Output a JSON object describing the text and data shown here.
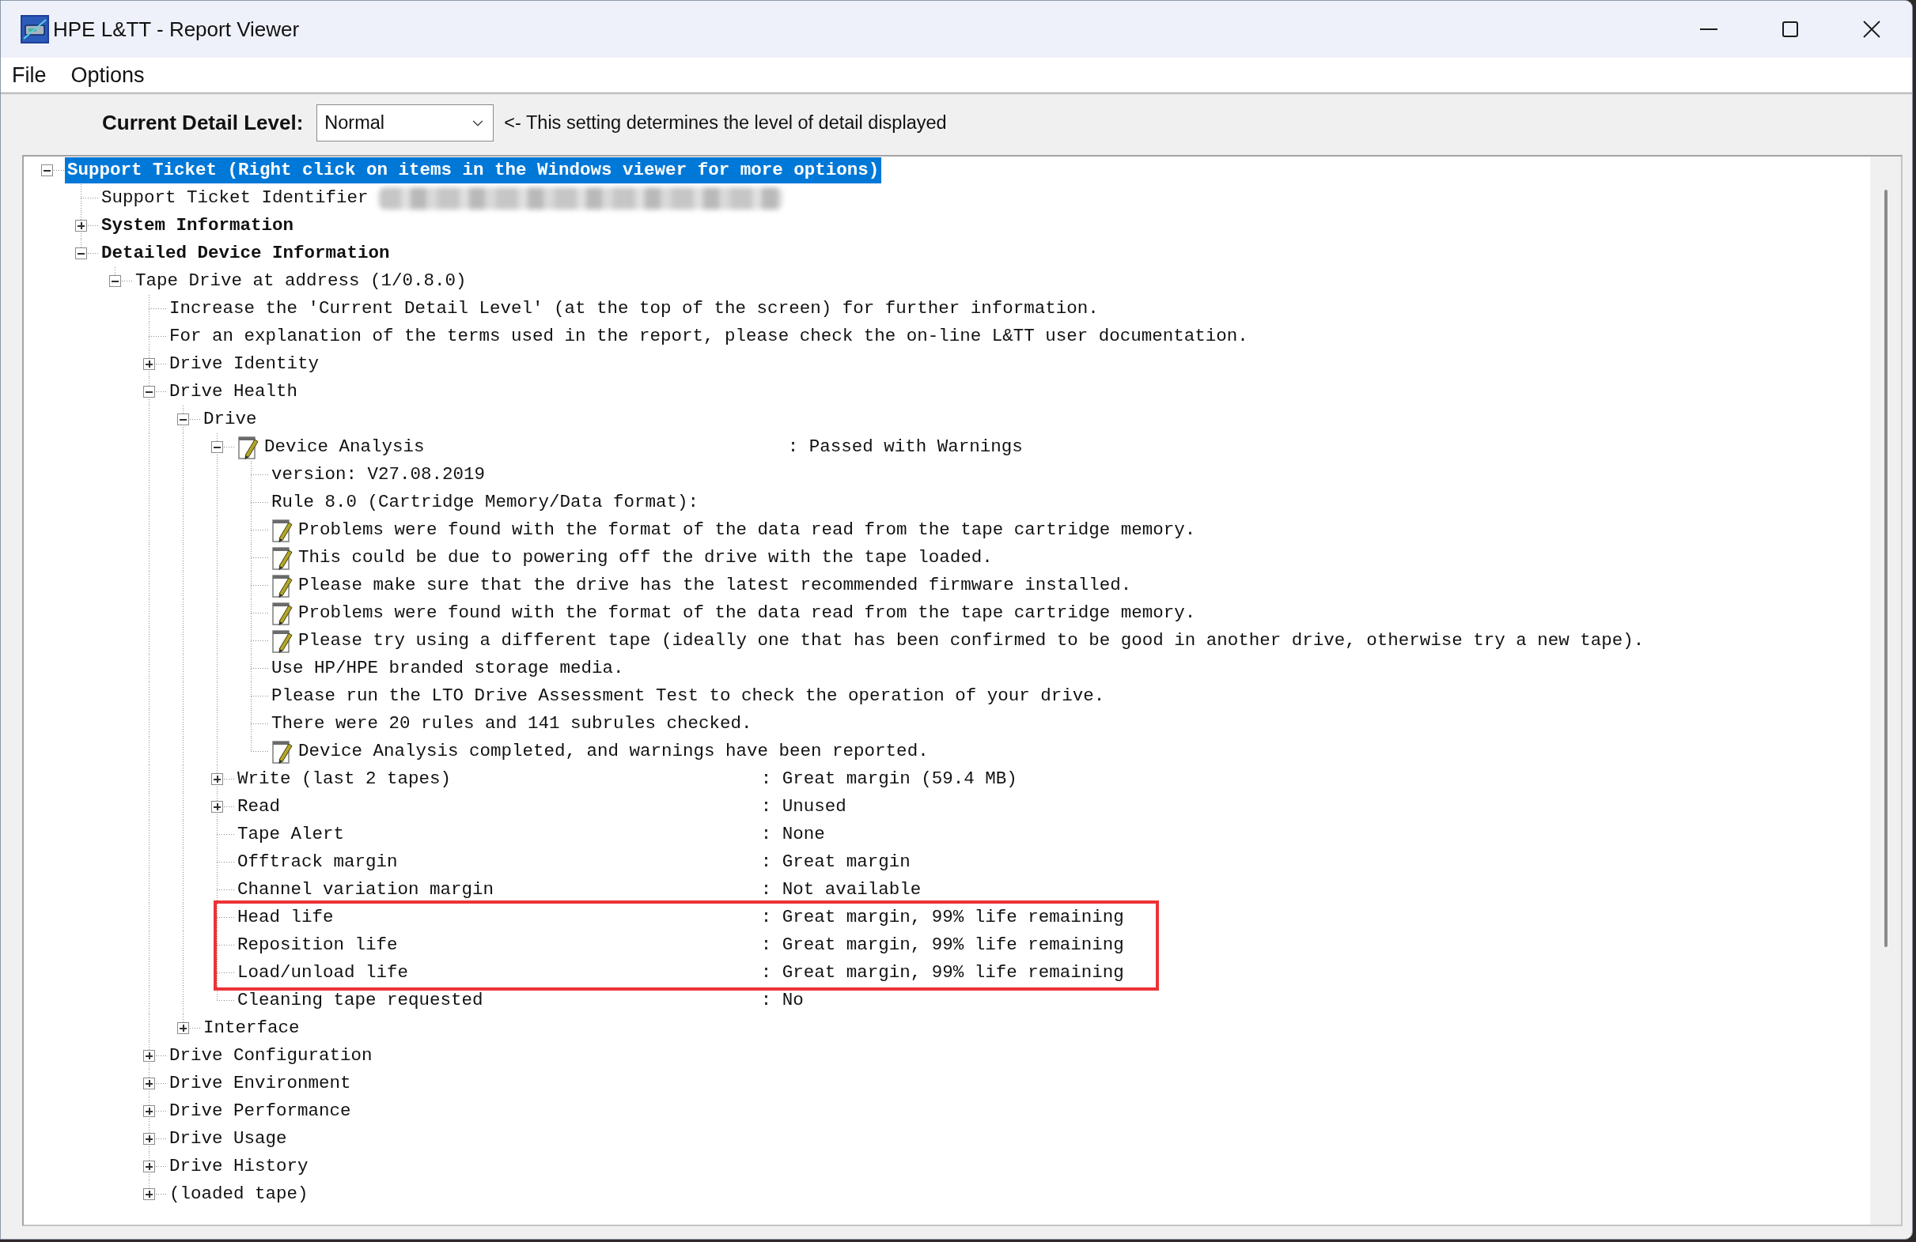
{
  "window": {
    "title": "HPE L&TT - Report Viewer"
  },
  "menu": [
    "File",
    "Options"
  ],
  "detail_level": {
    "label": "Current Detail Level:",
    "value": "Normal",
    "hint": "<- This setting determines the level of detail displayed"
  },
  "tree": [
    {
      "label": "Support Ticket (Right click on items in the Windows viewer for more options)",
      "bold": true,
      "selected": true,
      "expanded": true,
      "children": [
        {
          "label": "Support Ticket Identifier",
          "selected": false,
          "redacted": true
        },
        {
          "label": "System Information",
          "bold": true,
          "selected": false,
          "expanded": false
        },
        {
          "label": "Detailed Device Information",
          "bold": true,
          "selected": false,
          "expanded": true,
          "children": [
            {
              "label": "Tape Drive at address (1/0.8.0)",
              "selected": false,
              "expanded": true,
              "children": [
                {
                  "label": "Increase the 'Current Detail Level' (at the top of the screen) for further information.",
                  "selected": false
                },
                {
                  "label": "For an explanation of the terms used in the report, please check the on-line L&TT user documentation.",
                  "selected": false
                },
                {
                  "label": "Drive Identity",
                  "selected": false,
                  "expanded": false
                },
                {
                  "label": "Drive Health",
                  "selected": false,
                  "expanded": true,
                  "children": [
                    {
                      "label": "Drive",
                      "selected": false,
                      "expanded": true,
                      "children": [
                        {
                          "label": "Device Analysis",
                          "kind": "note",
                          "selected": false,
                          "expanded": true,
                          "value": ": Passed with Warnings",
                          "children": [
                            {
                              "label": "version: V27.08.2019",
                              "selected": false
                            },
                            {
                              "label": "Rule 8.0 (Cartridge Memory/Data format):",
                              "selected": false
                            },
                            {
                              "label": "Problems were found with the format of the data read from the tape cartridge memory.",
                              "kind": "note",
                              "selected": false
                            },
                            {
                              "label": "This could be due to powering off the drive with the tape loaded.",
                              "kind": "note",
                              "selected": false
                            },
                            {
                              "label": "Please make sure that the drive has the latest recommended firmware installed.",
                              "kind": "note",
                              "selected": false
                            },
                            {
                              "label": "Problems were found with the format of the data read from the tape cartridge memory.",
                              "kind": "note",
                              "selected": false
                            },
                            {
                              "label": "Please try using a different tape (ideally one that has been confirmed to be good in another drive, otherwise try a new tape).",
                              "kind": "note",
                              "selected": false
                            },
                            {
                              "label": "Use HP/HPE branded storage media.",
                              "selected": false
                            },
                            {
                              "label": "Please run the LTO Drive Assessment Test to check the operation of your drive.",
                              "selected": false
                            },
                            {
                              "label": "There were 20 rules and 141 subrules checked.",
                              "selected": false
                            },
                            {
                              "label": "Device Analysis completed, and warnings have been reported.",
                              "kind": "note",
                              "selected": false
                            }
                          ]
                        },
                        {
                          "label": "Write (last 2 tapes)",
                          "selected": false,
                          "expanded": false,
                          "value": ": Great margin (59.4 MB)"
                        },
                        {
                          "label": "Read",
                          "selected": false,
                          "expanded": false,
                          "value": ": Unused"
                        },
                        {
                          "label": "Tape Alert",
                          "selected": false,
                          "value": ": None"
                        },
                        {
                          "label": "Offtrack margin",
                          "selected": false,
                          "value": ": Great margin"
                        },
                        {
                          "label": "Channel variation margin",
                          "selected": false,
                          "value": ": Not available"
                        },
                        {
                          "label": "Head life",
                          "selected": false,
                          "value": ": Great margin, 99% life remaining",
                          "highlighted": true
                        },
                        {
                          "label": "Reposition life",
                          "selected": false,
                          "value": ": Great margin, 99% life remaining",
                          "highlighted": true
                        },
                        {
                          "label": "Load/unload life",
                          "selected": false,
                          "value": ": Great margin, 99% life remaining",
                          "highlighted": true
                        },
                        {
                          "label": "Cleaning tape requested",
                          "selected": false,
                          "value": ": No"
                        }
                      ]
                    },
                    {
                      "label": "Interface",
                      "selected": false,
                      "expanded": false
                    }
                  ]
                },
                {
                  "label": "Drive Configuration",
                  "selected": false,
                  "expanded": false
                },
                {
                  "label": "Drive Environment",
                  "selected": false,
                  "expanded": false
                },
                {
                  "label": "Drive Performance",
                  "selected": false,
                  "expanded": false
                },
                {
                  "label": "Drive Usage",
                  "selected": false,
                  "expanded": false
                },
                {
                  "label": "Drive History",
                  "selected": false,
                  "expanded": false
                },
                {
                  "label": "(loaded tape)",
                  "selected": false,
                  "expanded": false
                }
              ]
            }
          ]
        }
      ]
    }
  ]
}
